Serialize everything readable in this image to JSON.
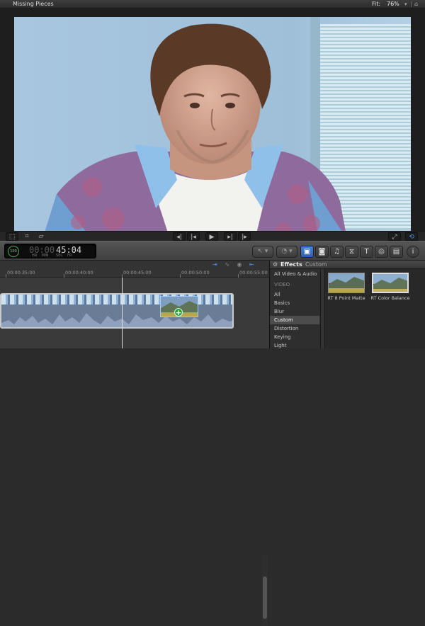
{
  "viewer": {
    "title": "Missing Pieces",
    "fit_label": "Fit:",
    "fit_value": "76%",
    "caret": "▾",
    "mini": "⌂"
  },
  "viewer_tools": {
    "prev_edit": "◂|",
    "prev_frame": "|◂",
    "play": "▶",
    "next_frame": "▸|",
    "next_edit": "|▸",
    "fullscreen": "⤢",
    "loop": "⟲"
  },
  "toolbar": {
    "timecode_prefix": "00:00",
    "timecode_main": "45:04",
    "timecode_units": [
      "HR",
      "MIN",
      "SEC",
      "FR"
    ],
    "ring_label": "100",
    "tool_pill": "↖ ▾",
    "audio_pill": "◔ ▾",
    "info": "i"
  },
  "timeline": {
    "ticks": [
      "00:00:35:00",
      "00:00:40:00",
      "00:00:45:00",
      "00:00:50:00",
      "00:00:55:00"
    ],
    "plus": "+"
  },
  "effects": {
    "title": "Effects",
    "subtitle": "Custom",
    "categories": [
      "All Video & Audio",
      "VIDEO",
      "All",
      "Basics",
      "Blur",
      "Custom",
      "Distortion",
      "Keying",
      "Light"
    ],
    "selected_category": "Custom",
    "presets": [
      {
        "label": "RT 8 Point Matte",
        "selected": false
      },
      {
        "label": "RT Color Balance",
        "selected": true
      }
    ]
  },
  "colors": {
    "accent": "#3d74cc",
    "add_badge": "#2c9b3a"
  }
}
